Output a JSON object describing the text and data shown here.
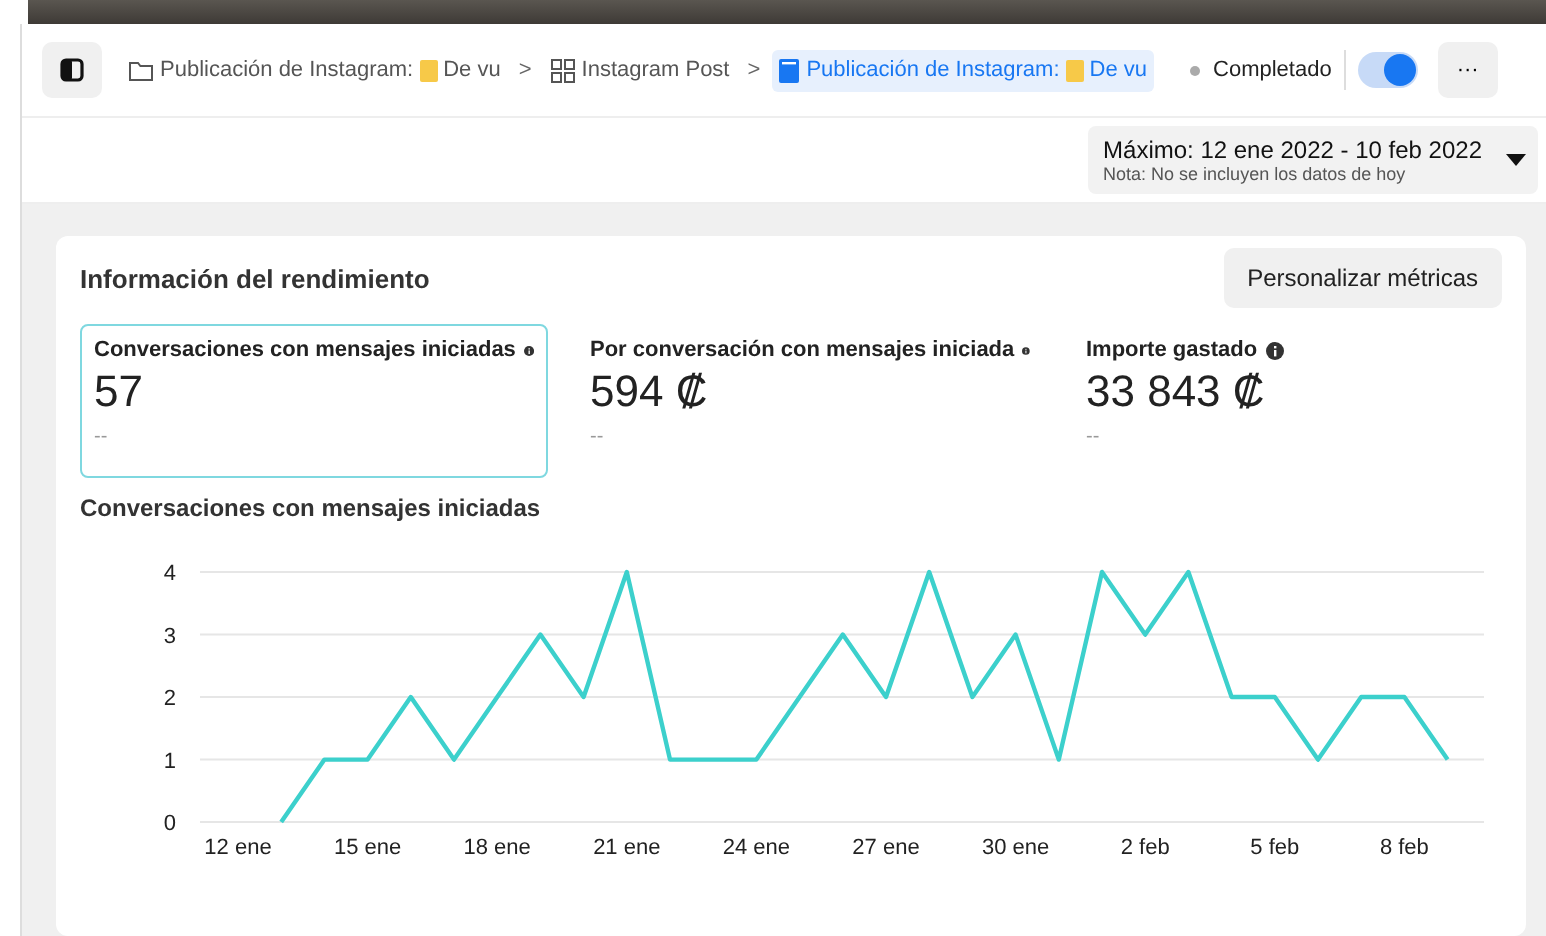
{
  "breadcrumbs": [
    {
      "kind": "folder",
      "label": "Publicación de Instagram:",
      "sub": "De vu",
      "selected": false
    },
    {
      "kind": "grid",
      "label": "Instagram Post",
      "selected": false
    },
    {
      "kind": "doc",
      "label": "Publicación de Instagram:",
      "sub": "De vu",
      "selected": true
    }
  ],
  "breadcrumb_separators": [
    ">",
    ">"
  ],
  "status": {
    "label": "Completado",
    "on": true
  },
  "more_button": "···",
  "date_range": {
    "label": "Máximo: 12 ene 2022 - 10 feb 2022",
    "note": "Nota: No se incluyen los datos de hoy"
  },
  "panel": {
    "title": "Información del rendimiento",
    "button": "Personalizar métricas",
    "metrics": [
      {
        "label": "Conversaciones con mensajes iniciadas",
        "value": "57",
        "comparison": "--",
        "selected": true
      },
      {
        "label": "Por conversación con mensajes iniciada",
        "value": "594 ₡",
        "comparison": "--",
        "selected": false
      },
      {
        "label": "Importe gastado",
        "value": "33 843 ₡",
        "comparison": "--",
        "selected": false
      }
    ],
    "chart_title": "Conversaciones con mensajes iniciadas",
    "chart_data": {
      "type": "line",
      "categories": [
        "12 ene",
        null,
        null,
        "15 ene",
        null,
        null,
        "18 ene",
        null,
        null,
        "21 ene",
        null,
        null,
        "24 ene",
        null,
        null,
        "27 ene",
        null,
        null,
        "30 ene",
        null,
        null,
        "2 feb",
        null,
        null,
        "5 feb",
        null,
        null,
        "8 feb",
        null
      ],
      "series": [
        {
          "color": "#3cd0cc",
          "values": [
            null,
            0,
            1,
            1,
            2,
            1,
            2,
            3,
            2,
            4,
            1,
            1,
            1,
            2,
            3,
            2,
            4,
            2,
            3,
            1,
            4,
            3,
            4,
            2,
            2,
            1,
            2,
            2,
            1
          ]
        }
      ],
      "ylim": [
        0,
        4
      ],
      "yticks": [
        0,
        1,
        2,
        3,
        4
      ],
      "grid": true
    }
  }
}
